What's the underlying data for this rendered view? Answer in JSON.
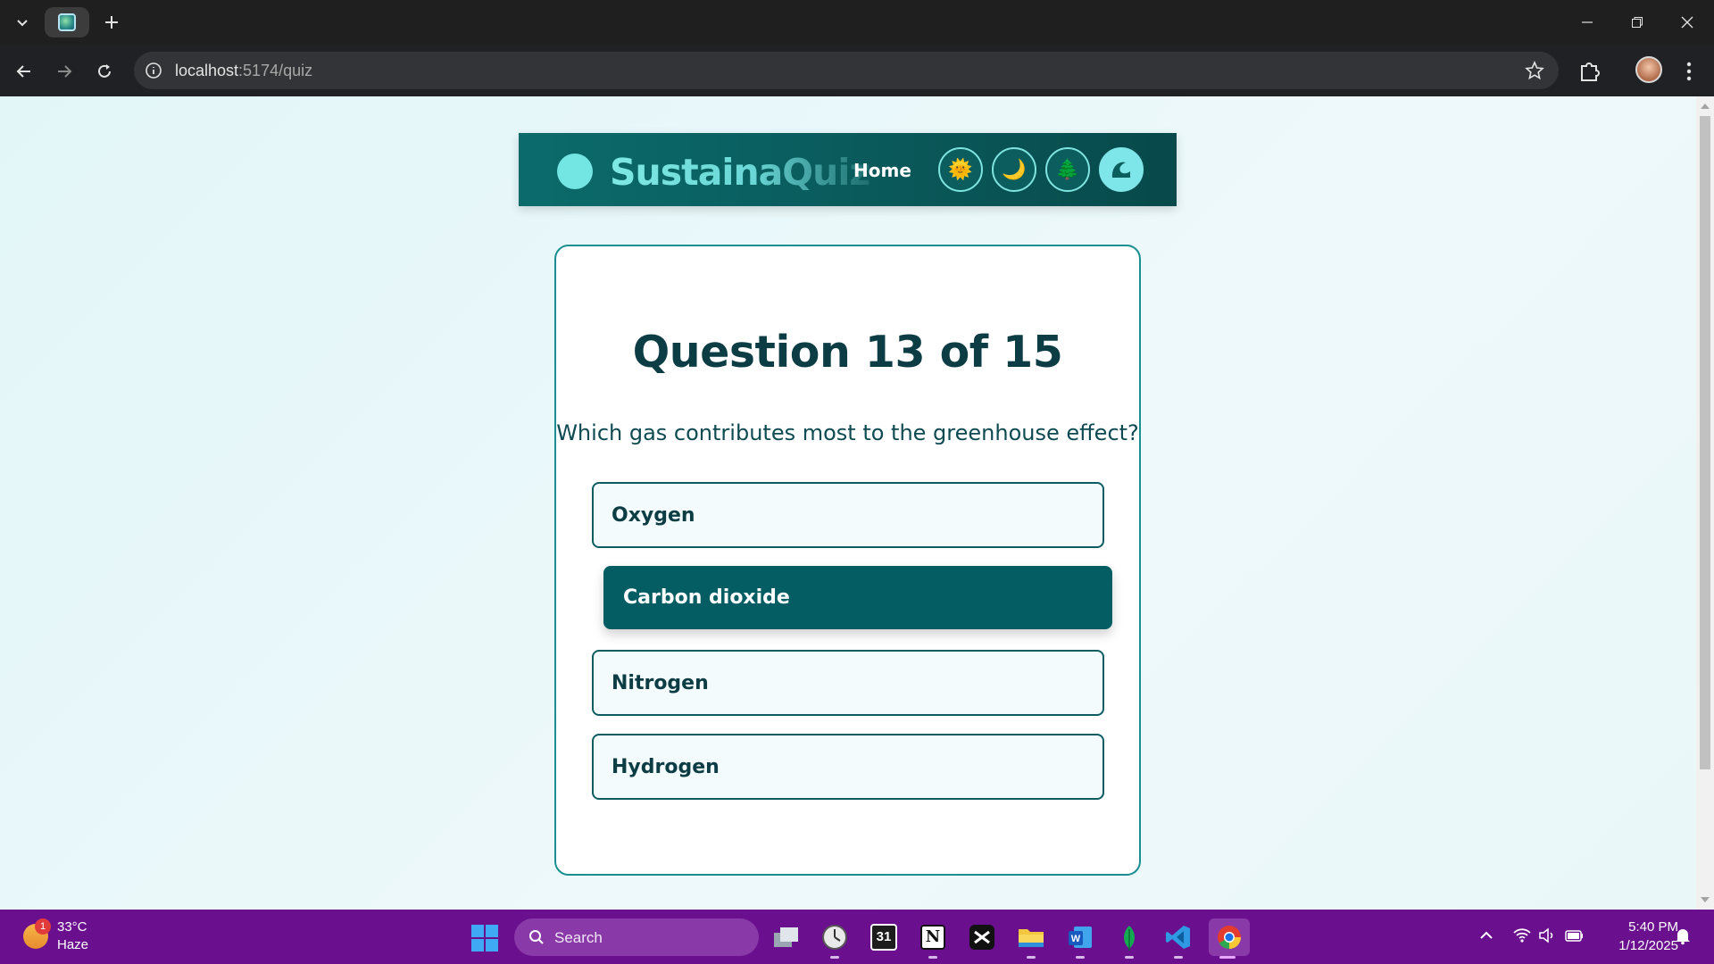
{
  "browser": {
    "url_host": "localhost",
    "url_path": ":5174/quiz"
  },
  "site": {
    "brand": "SustainaQuiz",
    "nav_home": "Home",
    "theme_buttons": [
      {
        "icon": "sun-icon",
        "glyph": "🌞"
      },
      {
        "icon": "moon-icon",
        "glyph": "🌙"
      },
      {
        "icon": "tree-icon",
        "glyph": "🌲"
      },
      {
        "icon": "wave-icon",
        "glyph": ""
      }
    ]
  },
  "quiz": {
    "title": "Question 13 of 15",
    "question": "Which gas contributes most to the greenhouse effect?",
    "options": [
      "Oxygen",
      "Carbon dioxide",
      "Nitrogen",
      "Hydrogen"
    ],
    "selected_index": 1
  },
  "taskbar": {
    "weather_badge": "1",
    "temperature": "33°C",
    "condition": "Haze",
    "search_placeholder": "Search",
    "calendar_day": "31",
    "time": "5:40 PM",
    "date": "1/12/2025"
  },
  "colors": {
    "accent": "#035d62",
    "taskbar": "#6a0f8e"
  }
}
